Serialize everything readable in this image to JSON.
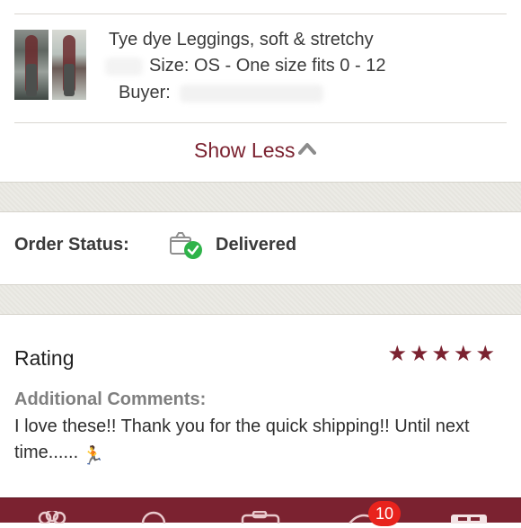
{
  "item": {
    "title": "Tye dye Leggings, soft & stretchy",
    "size_label": "Size:",
    "size_value": "OS - One size fits 0 - 12",
    "buyer_label": "Buyer:"
  },
  "show_less": {
    "label": "Show Less",
    "icon": "chevron-up-icon"
  },
  "order_status": {
    "label": "Order Status:",
    "value": "Delivered",
    "icon": "package-delivered-icon"
  },
  "rating": {
    "label": "Rating",
    "stars": 5,
    "max_stars": 5,
    "additional_comments_label": "Additional Comments:",
    "comment": "I love these!! Thank you for the quick shipping!! Until next time......",
    "comment_emoji": "🏃"
  },
  "tabbar": {
    "icons": [
      "community-icon",
      "search-icon",
      "camera-icon",
      "news-icon",
      "closet-icon"
    ],
    "news_badge": "10"
  },
  "colors": {
    "brand": "#7b2230",
    "delivered_check": "#2fb34a",
    "badge": "#e8231d"
  }
}
